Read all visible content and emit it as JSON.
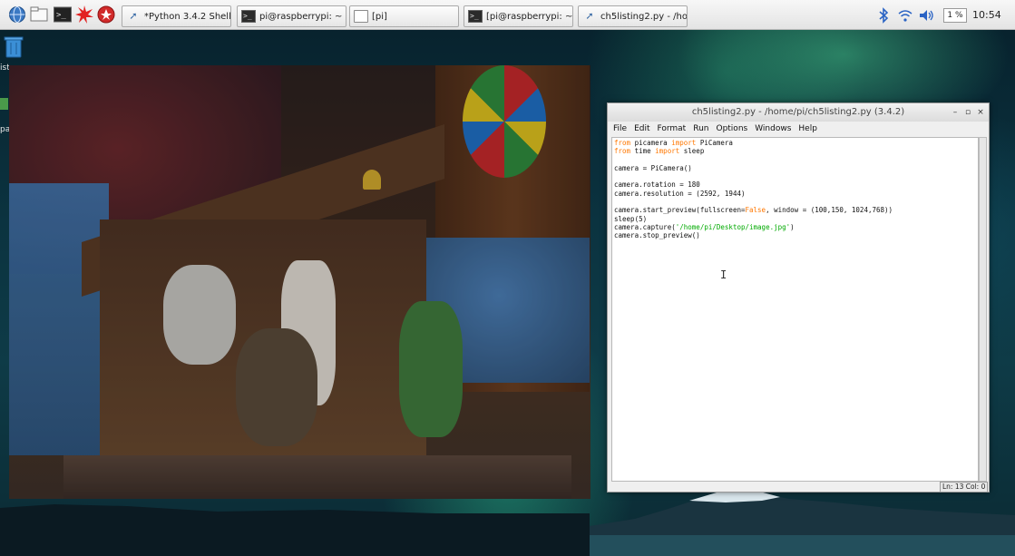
{
  "taskbar": {
    "launchers": [
      {
        "name": "globe-icon"
      },
      {
        "name": "file-manager-icon"
      },
      {
        "name": "terminal-icon"
      },
      {
        "name": "burst-icon"
      },
      {
        "name": "wolfram-icon"
      }
    ],
    "tasks": [
      {
        "label": "*Python 3.4.2 Shell*",
        "icon": "python-icon"
      },
      {
        "label": "pi@raspberrypi: ~",
        "icon": "terminal-icon"
      },
      {
        "label": "[pi]",
        "icon": "folder-icon"
      },
      {
        "label": "[pi@raspberrypi: ~]",
        "icon": "terminal-icon"
      },
      {
        "label": "ch5listing2.py - /ho...",
        "icon": "python-icon"
      }
    ],
    "tray": {
      "cpu_label": "1 %",
      "clock": "10:54"
    }
  },
  "desktop": {
    "left_fragment_1": "ist",
    "left_fragment_2": "pa"
  },
  "editor": {
    "title": "ch5listing2.py - /home/pi/ch5listing2.py (3.4.2)",
    "menu": [
      "File",
      "Edit",
      "Format",
      "Run",
      "Options",
      "Windows",
      "Help"
    ],
    "status": "Ln: 13 Col: 0",
    "code_lines": [
      [
        {
          "t": "from",
          "c": "kw"
        },
        {
          "t": " picamera "
        },
        {
          "t": "import",
          "c": "kw"
        },
        {
          "t": " PiCamera"
        }
      ],
      [
        {
          "t": "from",
          "c": "kw"
        },
        {
          "t": " time "
        },
        {
          "t": "import",
          "c": "kw"
        },
        {
          "t": " sleep"
        }
      ],
      [],
      [
        {
          "t": "camera = PiCamera()"
        }
      ],
      [],
      [
        {
          "t": "camera.rotation = 180"
        }
      ],
      [
        {
          "t": "camera.resolution = (2592, 1944)"
        }
      ],
      [],
      [
        {
          "t": "camera.start_preview(fullscreen="
        },
        {
          "t": "False",
          "c": "kw"
        },
        {
          "t": ", window = (100,150, 1024,768))"
        }
      ],
      [
        {
          "t": "sleep(5)"
        }
      ],
      [
        {
          "t": "camera.capture("
        },
        {
          "t": "'/home/pi/Desktop/image.jpg'",
          "c": "str"
        },
        {
          "t": ")"
        }
      ],
      [
        {
          "t": "camera.stop_preview()"
        }
      ]
    ]
  }
}
